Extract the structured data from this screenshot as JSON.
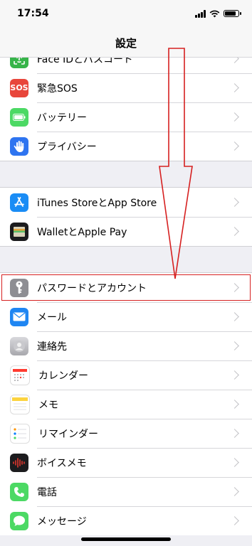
{
  "status_bar": {
    "time": "17:54"
  },
  "nav": {
    "title": "設定"
  },
  "groups": [
    {
      "rows": [
        {
          "label": "Face IDとパスコード",
          "icon": "faceid-icon",
          "color": "#37b44a"
        },
        {
          "label": "緊急SOS",
          "icon": "sos-icon",
          "icon_text": "SOS",
          "color": "#e8463b"
        },
        {
          "label": "バッテリー",
          "icon": "battery-icon",
          "color": "#4cd964"
        },
        {
          "label": "プライバシー",
          "icon": "hand-icon",
          "color": "#2e74f0"
        }
      ]
    },
    {
      "rows": [
        {
          "label": "iTunes StoreとApp Store",
          "icon": "app-store-icon",
          "color": "#1a8cf5"
        },
        {
          "label": "WalletとApple Pay",
          "icon": "wallet-icon",
          "color": "#1c1c1e"
        }
      ]
    },
    {
      "rows": [
        {
          "label": "パスワードとアカウント",
          "icon": "key-icon",
          "color": "#8e8e93",
          "highlighted": true
        },
        {
          "label": "メール",
          "icon": "mail-icon",
          "color": "#1f86f2"
        },
        {
          "label": "連絡先",
          "icon": "contacts-icon",
          "color": "#a8a8ad"
        },
        {
          "label": "カレンダー",
          "icon": "calendar-icon",
          "color": "#ffffff"
        },
        {
          "label": "メモ",
          "icon": "notes-icon",
          "color": "#ffffff"
        },
        {
          "label": "リマインダー",
          "icon": "reminders-icon",
          "color": "#ffffff"
        },
        {
          "label": "ボイスメモ",
          "icon": "voice-memo-icon",
          "color": "#1c1c1e"
        },
        {
          "label": "電話",
          "icon": "phone-icon",
          "color": "#4cd964"
        },
        {
          "label": "メッセージ",
          "icon": "messages-icon",
          "color": "#4cd964"
        }
      ]
    }
  ],
  "annotation": {
    "color": "#d62020"
  }
}
